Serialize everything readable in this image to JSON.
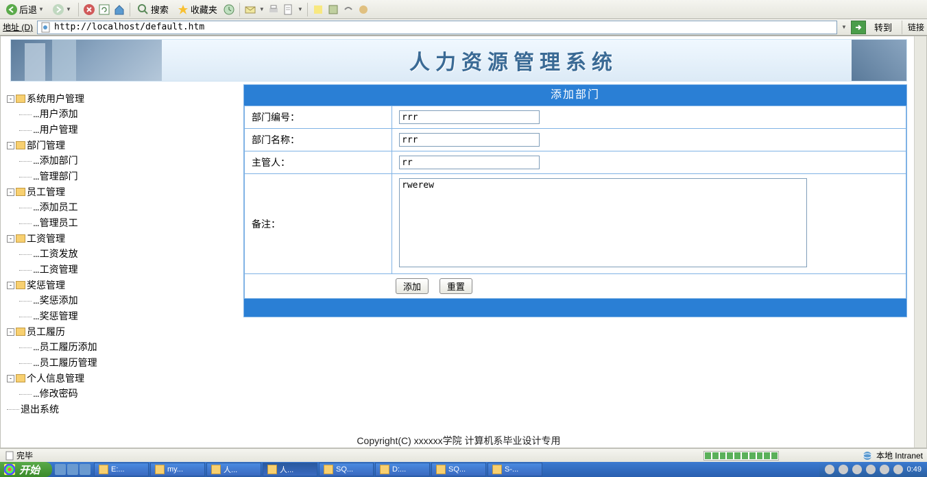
{
  "toolbar": {
    "back": "后退",
    "search": "搜索",
    "favorites": "收藏夹"
  },
  "addressbar": {
    "label": "地址 (D)",
    "url": "http://localhost/default.htm",
    "goto": "转到",
    "links": "链接"
  },
  "banner": {
    "title": "人力资源管理系统"
  },
  "sidebar": {
    "items": [
      {
        "label": "系统用户管理",
        "children": [
          "用户添加",
          "用户管理"
        ]
      },
      {
        "label": "部门管理",
        "children": [
          "添加部门",
          "管理部门"
        ]
      },
      {
        "label": "员工管理",
        "children": [
          "添加员工",
          "管理员工"
        ]
      },
      {
        "label": "工资管理",
        "children": [
          "工资发放",
          "工资管理"
        ]
      },
      {
        "label": "奖惩管理",
        "children": [
          "奖惩添加",
          "奖惩管理"
        ]
      },
      {
        "label": "员工履历",
        "children": [
          "员工履历添加",
          "员工履历管理"
        ]
      },
      {
        "label": "个人信息管理",
        "children": [
          "修改密码"
        ]
      },
      {
        "label": "退出系统",
        "children": []
      }
    ]
  },
  "form": {
    "title": "添加部门",
    "fields": {
      "dept_no_label": "部门编号：",
      "dept_no_value": "rrr",
      "dept_name_label": "部门名称：",
      "dept_name_value": "rrr",
      "manager_label": "主管人：",
      "manager_value": "rr",
      "remark_label": "备注：",
      "remark_value": "rwerew"
    },
    "buttons": {
      "submit": "添加",
      "reset": "重置"
    }
  },
  "copyright": "Copyright(C) xxxxxx学院 计算机系毕业设计专用",
  "statusbar": {
    "done": "完毕",
    "zone": "本地 Intranet"
  },
  "taskbar": {
    "start": "开始",
    "tasks": [
      "E:...",
      "my...",
      "人...",
      "人...",
      "SQ...",
      "D:...",
      "SQ...",
      "S-..."
    ],
    "clock": "0:49"
  }
}
